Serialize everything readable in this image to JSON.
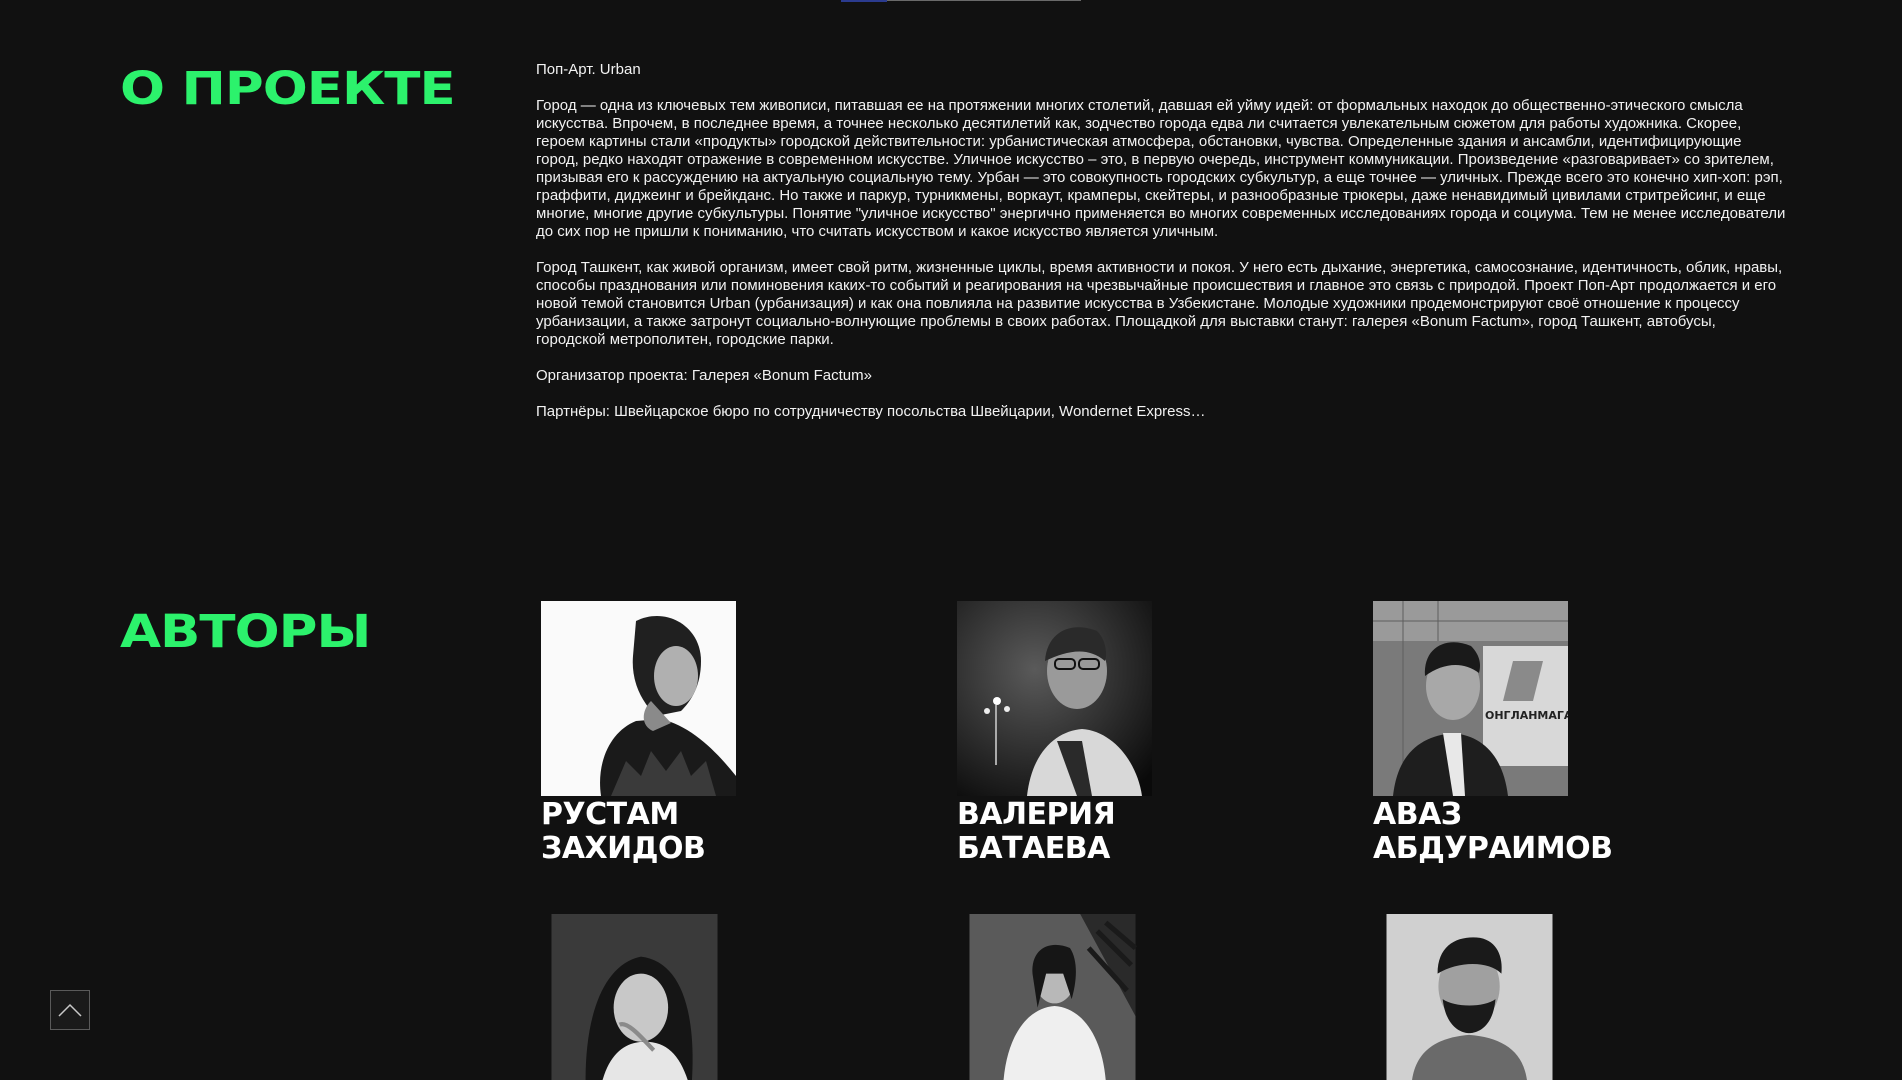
{
  "about": {
    "title": "О ПРОЕКТЕ",
    "lead": "Поп-Арт. Urban",
    "paragraph1": "Город — одна из ключевых тем живописи, питавшая ее на протяжении многих столетий, давшая ей уйму идей: от формальных находок до общественно-этического смысла искусства. Впрочем, в последнее время, а точнее несколько десятилетий как, зодчество города едва ли считается увлекательным сюжетом для работы художника. Скорее, героем картины стали «продукты» городской действительности: урбанистическая атмосфера, обстановки, чувства. Определенные здания и ансамбли, идентифицирующие город, редко находят отражение в современном искусстве. Уличное искусство – это, в первую очередь, инструмент коммуникации. Произведение «разговаривает» со зрителем, призывая его к рассуждению на актуальную социальную тему. Урбан — это совокупность городских субкультур, а еще точнее — уличных. Прежде всего это конечно хип-хоп: рэп, граффити, диджеинг и брейкданс. Но также и паркур, турникмены, воркаут, крамперы, скейтеры, и разнообразные трюкеры, даже ненавидимый цивилами стритрейсинг, и еще многие, многие другие субкультуры. Понятие \"уличное искусство\" энергично применяется во многих современных исследованиях города и социума. Тем не менее исследователи до сих пор не пришли к пониманию, что считать искусством и какое искусство является уличным.",
    "paragraph2": "Город Ташкент, как живой организм, имеет свой ритм, жизненные циклы, время активности и покоя. У него есть дыхание, энергетика, самосознание, идентичность, облик, нравы, способы празднования или поминовения каких-то событий и реагирования на чрезвычайные происшествия и главное это связь с природой. Проект Поп-Арт продолжается и его новой темой становится Urban (урбанизация) и как она повлияла на развитие искусства в Узбекистане. Молодые художники продемонстрируют своё отношение к процессу урбанизации, а также затронут социально-волнующие проблемы в своих работах. Площадкой для выставки станут: галерея «Bonum Factum», город Ташкент, автобусы, городской метрополитен, городские парки.",
    "organizer": "Организатор проекта: Галерея «Bonum Factum»",
    "partners": "Партнёры: Швейцарское бюро по сотрудничеству посольства Швейцарии, Wondernet Express…"
  },
  "authors": {
    "title": "АВТОРЫ",
    "people": [
      {
        "first": "РУСТАМ",
        "last": "ЗАХИДОВ"
      },
      {
        "first": "ВАЛЕРИЯ",
        "last": "БАТАЕВА"
      },
      {
        "first": "АВАЗ",
        "last": "АБДУРАИМОВ"
      }
    ],
    "sign_text": "ОНГЛАНМАГАН"
  },
  "accent_color": "#2cf26c",
  "background_color": "#111111",
  "icons": {
    "to_top": "chevron-up-icon"
  }
}
